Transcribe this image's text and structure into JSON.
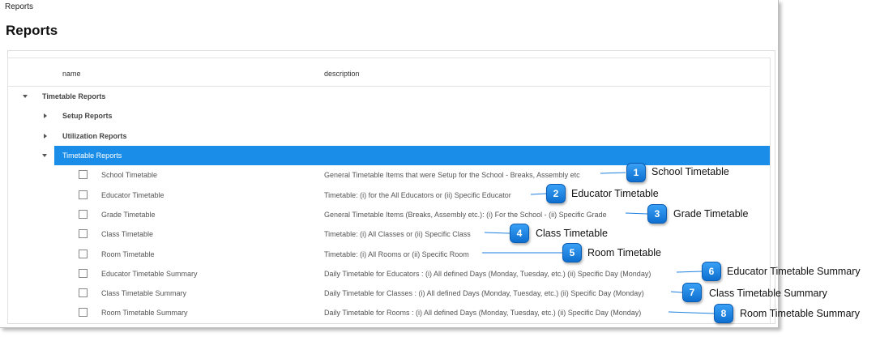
{
  "window": {
    "title": "Reports"
  },
  "page": {
    "heading": "Reports"
  },
  "grid": {
    "columns": {
      "name": "name",
      "description": "description"
    },
    "groups": {
      "root": "Timetable Reports",
      "setup": "Setup Reports",
      "utilization": "Utilization Reports",
      "timetable": "Timetable Reports"
    },
    "reports": [
      {
        "name": "School Timetable",
        "description": "General Timetable Items that were Setup for the School - Breaks, Assembly etc"
      },
      {
        "name": "Educator Timetable",
        "description": "Timetable: (i) for the All Educators or (ii) Specific Educator"
      },
      {
        "name": "Grade Timetable",
        "description": "General Timetable Items (Breaks, Assembly etc.): (i) For the School - (ii) Specific Grade"
      },
      {
        "name": "Class Timetable",
        "description": "Timetable: (i) All Classes or (ii) Specific Class"
      },
      {
        "name": "Room Timetable",
        "description": "Timetable: (i) All Rooms or (ii) Specific Room"
      },
      {
        "name": "Educator Timetable Summary",
        "description": "Daily Timetable for Educators : (i) All defined Days (Monday, Tuesday, etc.) (ii) Specific Day (Monday)"
      },
      {
        "name": "Class Timetable Summary",
        "description": "Daily Timetable for Classes : (i) All defined Days (Monday, Tuesday, etc.) (ii) Specific Day (Monday)"
      },
      {
        "name": "Room Timetable Summary",
        "description": "Daily Timetable for Rooms : (i) All defined Days (Monday, Tuesday, etc.) (ii) Specific Day (Monday)"
      }
    ]
  },
  "callouts": [
    {
      "number": "1",
      "label": "School Timetable"
    },
    {
      "number": "2",
      "label": "Educator Timetable"
    },
    {
      "number": "3",
      "label": "Grade Timetable"
    },
    {
      "number": "4",
      "label": "Class Timetable"
    },
    {
      "number": "5",
      "label": "Room Timetable"
    },
    {
      "number": "6",
      "label": "Educator Timetable Summary"
    },
    {
      "number": "7",
      "label": "Class Timetable Summary"
    },
    {
      "number": "8",
      "label": "Room Timetable Summary"
    }
  ],
  "colors": {
    "selection": "#1a8de8",
    "callout": "#1a7fe0"
  }
}
